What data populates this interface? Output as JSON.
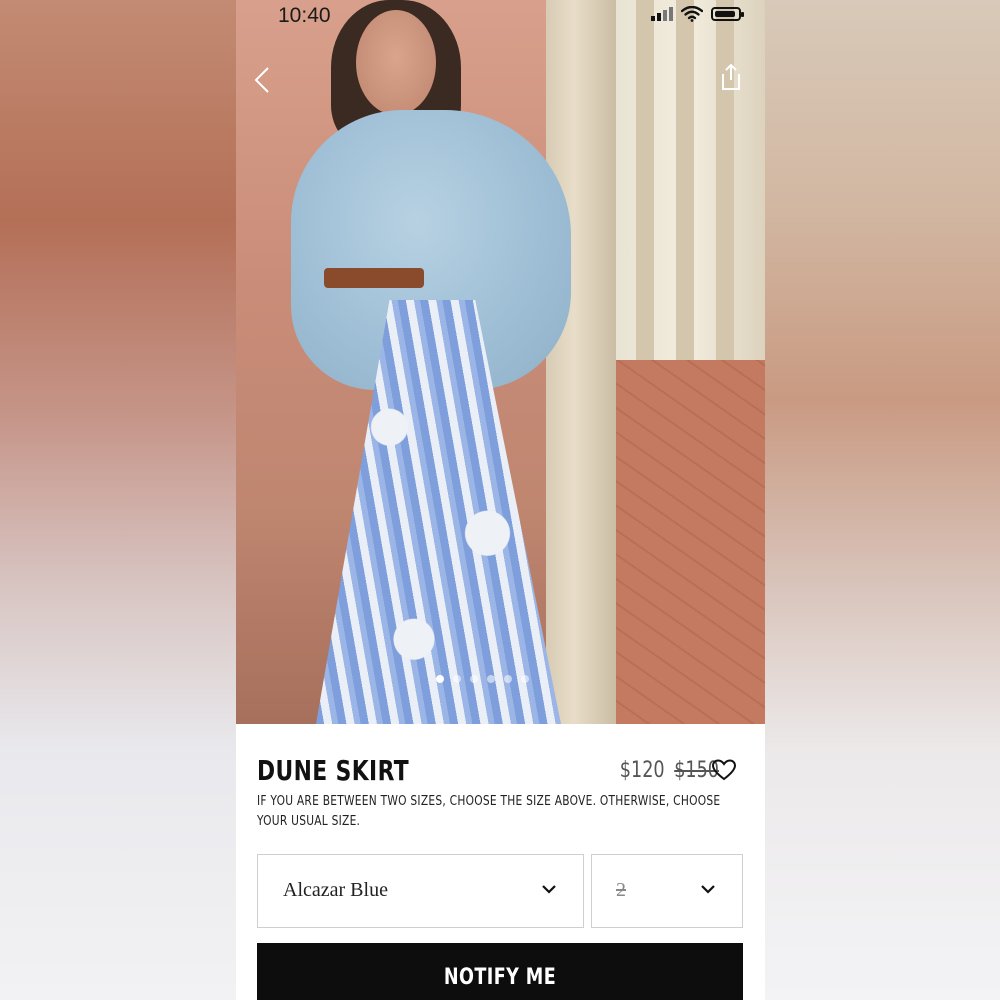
{
  "status_bar": {
    "time": "10:40"
  },
  "gallery": {
    "image_count": 6,
    "active_index": 0
  },
  "product": {
    "name": "DUNE SKIRT",
    "price": "$120",
    "original_price": "$150",
    "size_note": "IF YOU ARE BETWEEN TWO SIZES, CHOOSE THE SIZE ABOVE. OTHERWISE, CHOOSE YOUR USUAL SIZE."
  },
  "selectors": {
    "color_value": "Alcazar Blue",
    "size_value": "2"
  },
  "cta": {
    "label": "NOTIFY ME"
  }
}
